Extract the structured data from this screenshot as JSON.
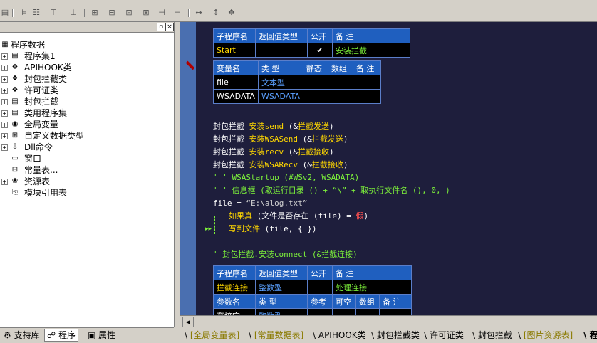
{
  "left_panel": {
    "tree": [
      {
        "label": "程序数据",
        "icon": "db-icon",
        "level": 0,
        "expander": ""
      },
      {
        "label": "程序集1",
        "icon": "assembly-icon",
        "level": 1,
        "expander": "+"
      },
      {
        "label": "APIHOOK类",
        "icon": "class-icon",
        "level": 1,
        "expander": "+"
      },
      {
        "label": "封包拦截类",
        "icon": "class-icon",
        "level": 1,
        "expander": "+"
      },
      {
        "label": "许可证类",
        "icon": "class-icon",
        "level": 1,
        "expander": "+"
      },
      {
        "label": "封包拦截",
        "icon": "assembly-icon",
        "level": 1,
        "expander": "+"
      },
      {
        "label": "类用程序集",
        "icon": "assembly-icon",
        "level": 1,
        "expander": "+"
      },
      {
        "label": "全局变量",
        "icon": "global-var-icon",
        "level": 1,
        "expander": "+"
      },
      {
        "label": "自定义数据类型",
        "icon": "datatype-icon",
        "level": 1,
        "expander": "+"
      },
      {
        "label": "Dll命令",
        "icon": "dll-icon",
        "level": 1,
        "expander": "+"
      },
      {
        "label": "窗口",
        "icon": "window-icon",
        "level": 1,
        "expander": ""
      },
      {
        "label": "常量表...",
        "icon": "constant-icon",
        "level": 1,
        "expander": ""
      },
      {
        "label": "资源表",
        "icon": "resource-icon",
        "level": 1,
        "expander": "+"
      },
      {
        "label": "模块引用表",
        "icon": "module-icon",
        "level": 1,
        "expander": ""
      }
    ],
    "tabs": [
      "支持库",
      "程序",
      "属性"
    ]
  },
  "editor": {
    "sub_table": {
      "headers": [
        "子程序名",
        "返回值类型",
        "公开",
        "备 注"
      ],
      "row": [
        "Start",
        "",
        "✔",
        "安装拦截"
      ]
    },
    "var_table": {
      "headers": [
        "变量名",
        "类 型",
        "静态",
        "数组",
        "备 注"
      ],
      "rows": [
        [
          "file",
          "文本型",
          "",
          "",
          ""
        ],
        [
          "WSADATA",
          "WSADATA",
          "",
          "",
          ""
        ]
      ]
    },
    "code_lines": [
      [
        [
          "封包拦截 ",
          "c-white"
        ],
        [
          "安装send",
          "c-yellow"
        ],
        [
          " (&",
          "c-white"
        ],
        [
          "拦截发送",
          "c-yellow"
        ],
        [
          ")",
          "c-white"
        ]
      ],
      [
        [
          "封包拦截 ",
          "c-white"
        ],
        [
          "安装WSASend",
          "c-yellow"
        ],
        [
          " (&",
          "c-white"
        ],
        [
          "拦截发送",
          "c-yellow"
        ],
        [
          ")",
          "c-white"
        ]
      ],
      [
        [
          "封包拦截 ",
          "c-white"
        ],
        [
          "安装recv",
          "c-yellow"
        ],
        [
          " (&",
          "c-white"
        ],
        [
          "拦截接收",
          "c-yellow"
        ],
        [
          ")",
          "c-white"
        ]
      ],
      [
        [
          "封包拦截 ",
          "c-white"
        ],
        [
          "安装WSARecv",
          "c-yellow"
        ],
        [
          " (&",
          "c-white"
        ],
        [
          "拦截接收",
          "c-yellow"
        ],
        [
          ")",
          "c-white"
        ]
      ],
      [
        [
          "' ' WSAStartup (#WSv2, WSADATA)",
          "c-green"
        ]
      ],
      [
        [
          "' ' 信息框 (取运行目录 () + “\\” + 取执行文件名 (), 0, )",
          "c-green"
        ]
      ],
      [
        [
          "file = ",
          "c-white"
        ],
        [
          "“E:\\alog.txt”",
          "c-gray"
        ]
      ],
      [
        [
          "如果真",
          "c-yellow"
        ],
        [
          " (文件是否存在 (file) = ",
          "c-white"
        ],
        [
          "假",
          "c-red"
        ],
        [
          ")",
          "c-white"
        ]
      ],
      [
        [
          "写到文件",
          "c-yellow"
        ],
        [
          " (file, { })",
          "c-white"
        ]
      ],
      [],
      [
        [
          "' 封包拦截.安装connect (&拦截连接)",
          "c-green"
        ]
      ]
    ],
    "sub_table2": {
      "headers": [
        "子程序名",
        "返回值类型",
        "公开",
        "备 注"
      ],
      "row": [
        "拦截连接",
        "整数型",
        "",
        "处理连接"
      ],
      "param_headers": [
        "参数名",
        "类 型",
        "参考",
        "可空",
        "数组",
        "备 注"
      ],
      "param_row": [
        "套接字",
        "整数型",
        "",
        "",
        "",
        ""
      ]
    }
  },
  "bottom_tabs": [
    "[全局变量表]",
    "[常量数据表]",
    "APIHOOK类",
    "封包拦截类",
    "许可证类",
    "封包拦截",
    "[图片资源表]",
    "程"
  ]
}
